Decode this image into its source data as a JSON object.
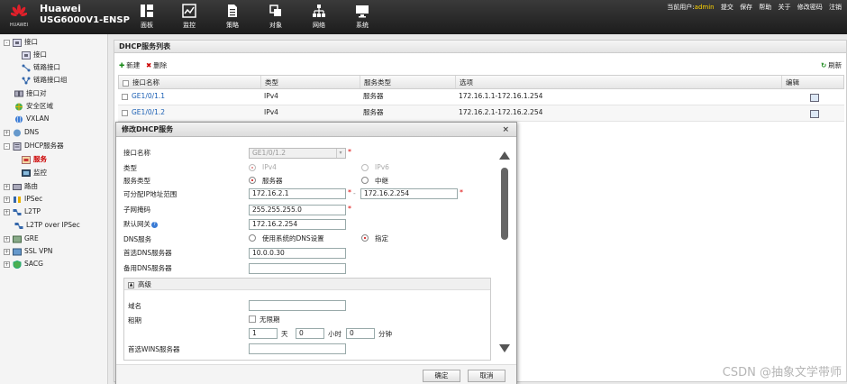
{
  "header": {
    "brand": "Huawei",
    "device": "USG6000V1-ENSP",
    "logo_text": "HUAWEI",
    "nav": [
      {
        "label": "面板",
        "icon": "dashboard-icon"
      },
      {
        "label": "监控",
        "icon": "monitor-icon"
      },
      {
        "label": "策略",
        "icon": "policy-icon"
      },
      {
        "label": "对象",
        "icon": "object-icon"
      },
      {
        "label": "网络",
        "icon": "network-icon"
      },
      {
        "label": "系统",
        "icon": "system-icon"
      }
    ],
    "current_user_label": "当前用户:",
    "current_user": "admin",
    "links": [
      "提交",
      "保存",
      "帮助",
      "关于",
      "修改密码",
      "注销"
    ]
  },
  "sidebar": {
    "items": [
      {
        "label": "接口",
        "expander": "-"
      },
      {
        "label": "接口"
      },
      {
        "label": "链路接口"
      },
      {
        "label": "链路接口组"
      },
      {
        "label": "接口对"
      },
      {
        "label": "安全区域"
      },
      {
        "label": "VXLAN"
      },
      {
        "label": "DNS",
        "expander": "+"
      },
      {
        "label": "DHCP服务器",
        "expander": "-"
      },
      {
        "label": "服务"
      },
      {
        "label": "监控"
      },
      {
        "label": "路由",
        "expander": "+"
      },
      {
        "label": "IPSec",
        "expander": "+"
      },
      {
        "label": "L2TP",
        "expander": "+"
      },
      {
        "label": "L2TP over IPSec"
      },
      {
        "label": "GRE",
        "expander": "+"
      },
      {
        "label": "SSL VPN",
        "expander": "+"
      },
      {
        "label": "SACG",
        "expander": "+"
      }
    ]
  },
  "panel": {
    "title": "DHCP服务列表",
    "toolbar": {
      "new": "新建",
      "delete": "删除",
      "refresh": "刷新"
    },
    "columns": [
      "接口名称",
      "类型",
      "服务类型",
      "选项",
      "编辑"
    ],
    "rows": [
      {
        "interface": "GE1/0/1.1",
        "type": "IPv4",
        "service": "服务器",
        "options": "172.16.1.1-172.16.1.254"
      },
      {
        "interface": "GE1/0/1.2",
        "type": "IPv4",
        "service": "服务器",
        "options": "172.16.2.1-172.16.2.254"
      }
    ]
  },
  "dialog": {
    "title": "修改DHCP服务",
    "close": "×",
    "fields": {
      "interface_label": "接口名称",
      "interface_value": "GE1/0/1.2",
      "type_label": "类型",
      "type_opt1": "IPv4",
      "type_opt2": "IPv6",
      "service_label": "服务类型",
      "service_opt1": "服务器",
      "service_opt2": "中继",
      "range_label": "可分配IP地址范围",
      "range_start": "172.16.2.1",
      "range_sep": "-",
      "range_end": "172.16.2.254",
      "mask_label": "子网掩码",
      "mask_value": "255.255.255.0",
      "gateway_label": "默认网关",
      "gateway_value": "172.16.2.254",
      "dns_label": "DNS服务",
      "dns_opt1": "使用系统的DNS设置",
      "dns_opt2": "指定",
      "dns1_label": "首选DNS服务器",
      "dns1_value": "10.0.0.30",
      "dns2_label": "备用DNS服务器",
      "dns2_value": ""
    },
    "advanced": {
      "title": "高级",
      "domain_label": "域名",
      "domain_value": "",
      "lease_label": "租期",
      "unlimited_label": "无限期",
      "days_value": "1",
      "days_unit": "天",
      "hours_value": "0",
      "hours_unit": "小时",
      "minutes_value": "0",
      "minutes_unit": "分钟",
      "wins_label": "首选WINS服务器",
      "wins_value": ""
    },
    "buttons": {
      "ok": "确定",
      "cancel": "取消"
    }
  },
  "watermark": "CSDN @抽象文学带师",
  "colors": {
    "accent_red": "#c00000",
    "link_blue": "#1a5fb4",
    "admin_yellow": "#ffd400"
  }
}
